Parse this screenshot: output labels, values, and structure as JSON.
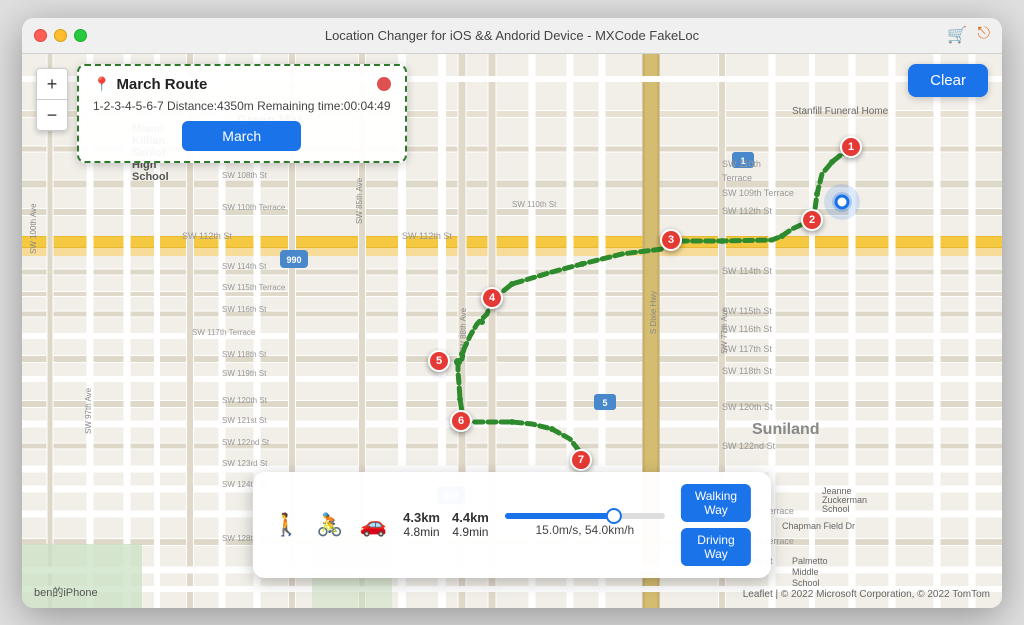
{
  "window": {
    "title": "Location Changer for iOS && Andorid Device - MXCode FakeLoc"
  },
  "titlebar": {
    "cart_icon": "🛒",
    "share_icon": "⎋"
  },
  "map": {
    "zoom_in": "+",
    "zoom_out": "−"
  },
  "route_card": {
    "title": "March Route",
    "route_text": "1-2-3-4-5-6-7 Distance:4350m",
    "remaining": "Remaining time:00:04:49",
    "march_button": "March"
  },
  "clear_button": "Clear",
  "markers": [
    {
      "id": 1,
      "label": "1"
    },
    {
      "id": 2,
      "label": "2"
    },
    {
      "id": 3,
      "label": "3"
    },
    {
      "id": 4,
      "label": "4"
    },
    {
      "id": 5,
      "label": "5"
    },
    {
      "id": 6,
      "label": "6"
    },
    {
      "id": 7,
      "label": "7"
    }
  ],
  "bottom_panel": {
    "distance1_val": "4.3km",
    "distance1_time": "4.8min",
    "distance2_val": "4.4km",
    "distance2_time": "4.9min",
    "speed_label": "15.0m/s, 54.0km/h",
    "walking_btn": "Walking\nWay",
    "driving_btn": "Driving\nWay"
  },
  "copyright": "Leaflet | © 2022 Microsoft Corporation, © 2022 TomTom",
  "device_label": "ben的iPhone"
}
